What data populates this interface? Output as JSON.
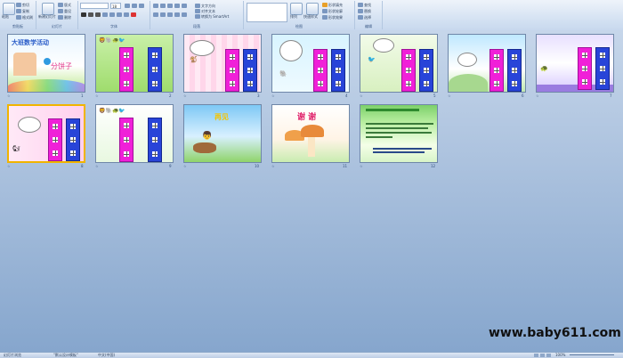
{
  "ribbon": {
    "clipboard": {
      "label": "剪贴板",
      "paste": "粘贴",
      "cut": "剪切",
      "copy": "复制",
      "format": "格式刷"
    },
    "slides": {
      "label": "幻灯片",
      "new_slide": "新建幻灯片",
      "layout": "版式",
      "reset": "重设",
      "delete": "删除"
    },
    "font": {
      "label": "字体",
      "font_name": "",
      "font_size": "18"
    },
    "paragraph": {
      "label": "段落",
      "text_direction": "文字方向",
      "align_text": "对齐文本",
      "smartart": "转换为 SmartArt"
    },
    "drawing": {
      "label": "绘图",
      "arrange": "排列",
      "quick_styles": "快速样式",
      "fill": "形状填充",
      "outline": "形状轮廓",
      "effects": "形状效果"
    },
    "editing": {
      "label": "编辑",
      "find": "查找",
      "replace": "替换",
      "select": "选择"
    }
  },
  "slides": [
    {
      "num": "1",
      "title": "大班数学活动",
      "subtitle": "分饼子"
    },
    {
      "num": "2"
    },
    {
      "num": "3"
    },
    {
      "num": "4"
    },
    {
      "num": "5"
    },
    {
      "num": "6"
    },
    {
      "num": "7"
    },
    {
      "num": "8"
    },
    {
      "num": "9"
    },
    {
      "num": "10",
      "title": "再见"
    },
    {
      "num": "11",
      "title": "谢 谢"
    },
    {
      "num": "12"
    }
  ],
  "watermark": "www.baby611.com",
  "statusbar": {
    "view": "幻灯片浏览",
    "theme": "\"默认设计模板\"",
    "language": "中文(中国)",
    "zoom": "100%"
  },
  "colors": {
    "house_pink": "#f020d8",
    "house_blue": "#2844d8",
    "stage_top": "#c6d6ea",
    "stage_bottom": "#86a6cd"
  }
}
